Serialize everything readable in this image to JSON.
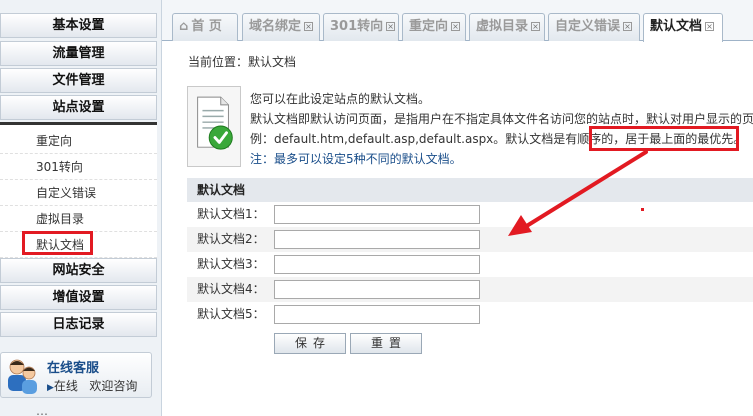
{
  "sidebar": {
    "sections_top": [
      "基本设置",
      "流量管理",
      "文件管理",
      "站点设置"
    ],
    "sub_items": [
      "重定向",
      "301转向",
      "自定义错误",
      "虚拟目录",
      "默认文档"
    ],
    "sections_bottom": [
      "网站安全",
      "增值设置",
      "日志记录"
    ],
    "support": {
      "title": "在线客服",
      "status": "在线",
      "consult": "欢迎咨询"
    },
    "tail_text": "…"
  },
  "tabs": [
    {
      "label": "首 页",
      "icon": "home-icon",
      "closable": false
    },
    {
      "label": "域名绑定",
      "closable": true
    },
    {
      "label": "301转向",
      "closable": true
    },
    {
      "label": "重定向",
      "closable": true
    },
    {
      "label": "虚拟目录",
      "closable": true
    },
    {
      "label": "自定义错误",
      "closable": true
    },
    {
      "label": "默认文档",
      "closable": true,
      "active": true
    }
  ],
  "tab_close_glyph": "×",
  "breadcrumb": "当前位置：默认文档",
  "info": {
    "line1": "您可以在此设定站点的默认文档。",
    "line2": "默认文档即默认访问页面，是指用户在不指定具体文件名访问您的站点时，默认对用户显示的页",
    "line3": "例：default.htm,default.asp,default.aspx。默认文档是有顺序的，居于最上面的最优先。",
    "note": "注：最多可以设定5种不同的默认文档。"
  },
  "form": {
    "title": "默认文档",
    "fields": [
      {
        "label": "默认文档1：",
        "value": ""
      },
      {
        "label": "默认文档2：",
        "value": ""
      },
      {
        "label": "默认文档3：",
        "value": ""
      },
      {
        "label": "默认文档4：",
        "value": ""
      },
      {
        "label": "默认文档5：",
        "value": ""
      }
    ],
    "save_label": "保存",
    "reset_label": "重置"
  },
  "colors": {
    "highlight": "#e21a22",
    "accent": "#1a4e8a"
  }
}
